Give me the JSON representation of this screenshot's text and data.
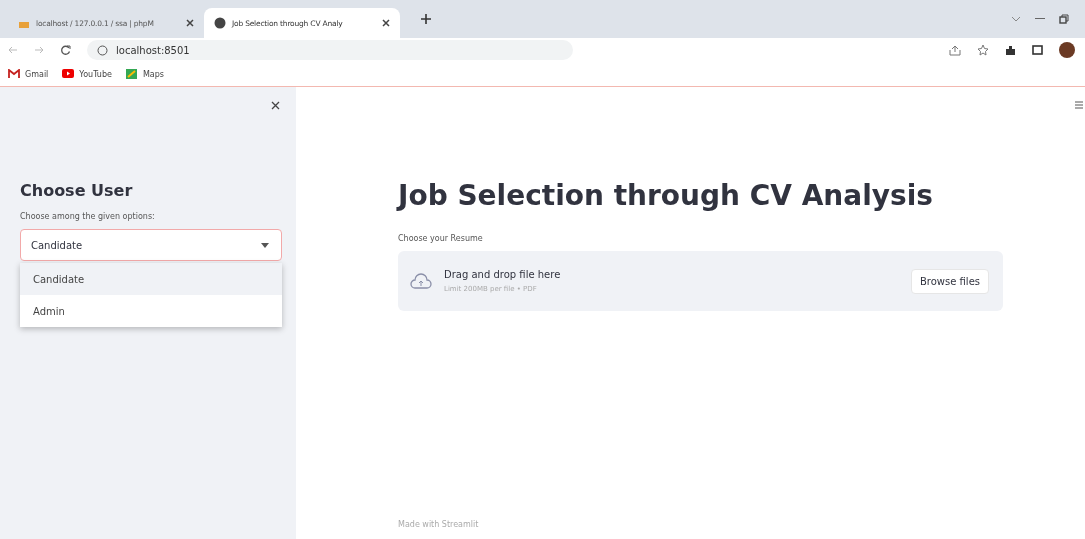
{
  "browser": {
    "tabs": [
      {
        "title": "localhost / 127.0.0.1 / ssa | phpM",
        "selected": false
      },
      {
        "title": "Job Selection through CV Analy",
        "selected": true
      }
    ],
    "address": "localhost:8501",
    "bookmarks": [
      "Gmail",
      "YouTube",
      "Maps"
    ]
  },
  "sidebar": {
    "heading": "Choose User",
    "select": {
      "label": "Choose among the given options:",
      "value": "Candidate",
      "expanded": true,
      "options": [
        {
          "label": "Candidate",
          "selected": true
        },
        {
          "label": "Admin",
          "selected": false
        }
      ]
    }
  },
  "main": {
    "title": "Job Selection through CV Analysis",
    "uploader": {
      "label": "Choose your Resume",
      "prompt": "Drag and drop file here",
      "limit": "Limit 200MB per file • PDF",
      "button": "Browse files"
    },
    "footer": "Made with Streamlit"
  }
}
